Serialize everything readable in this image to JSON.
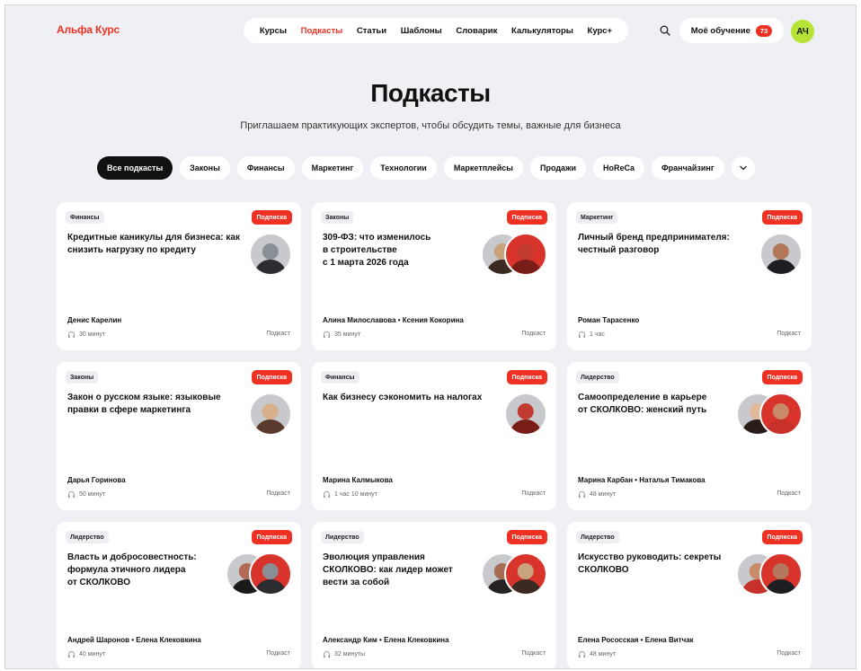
{
  "header": {
    "logo": "Альфа Курс",
    "nav": [
      {
        "label": "Курсы",
        "active": false
      },
      {
        "label": "Подкасты",
        "active": true
      },
      {
        "label": "Статьи",
        "active": false
      },
      {
        "label": "Шаблоны",
        "active": false
      },
      {
        "label": "Словарик",
        "active": false
      },
      {
        "label": "Калькуляторы",
        "active": false
      },
      {
        "label": "Курс+",
        "active": false
      }
    ],
    "search_icon": "search-icon",
    "learning_label": "Моё обучение",
    "learning_count": "73",
    "user_initials": "АЧ"
  },
  "hero": {
    "title": "Подкасты",
    "subtitle": "Приглашаем практикующих экспертов, чтобы обсудить темы, важные для бизнеса"
  },
  "filters": [
    {
      "label": "Все подкасты",
      "active": true
    },
    {
      "label": "Законы",
      "active": false
    },
    {
      "label": "Финансы",
      "active": false
    },
    {
      "label": "Маркетинг",
      "active": false
    },
    {
      "label": "Технологии",
      "active": false
    },
    {
      "label": "Маркетплейсы",
      "active": false
    },
    {
      "label": "Продажи",
      "active": false
    },
    {
      "label": "HoReCa",
      "active": false
    },
    {
      "label": "Франчайзинг",
      "active": false
    }
  ],
  "colors": {
    "accent": "#ef3124",
    "user_avatar": "#b7e335",
    "page_bg": "#eef0f3"
  },
  "cards": [
    {
      "tag": "Финансы",
      "badge": "Подписка",
      "title": "Кредитные каникулы для бизнеса: как снизить нагрузку по кредиту",
      "authors": "Денис Карелин",
      "duration": "30 минут",
      "kind": "Подкаст",
      "photos": 1
    },
    {
      "tag": "Законы",
      "badge": "Подписка",
      "title": "309-ФЗ: что изменилось\nв строительстве\nс 1 марта 2026 года",
      "authors": "Алина Милославова  • Ксения Кокорина",
      "duration": "35 минут",
      "kind": "Подкаст",
      "photos": 2
    },
    {
      "tag": "Маркетинг",
      "badge": "Подписка",
      "title": "Личный бренд предпринимателя: честный разговор",
      "authors": "Роман Тарасенко",
      "duration": "1 час",
      "kind": "Подкаст",
      "photos": 1
    },
    {
      "tag": "Законы",
      "badge": "Подписка",
      "title": "Закон о русском языке: языковые правки в сфере маркетинга",
      "authors": "Дарья Горинова",
      "duration": "50 минут",
      "kind": "Подкаст",
      "photos": 1
    },
    {
      "tag": "Финансы",
      "badge": "Подписка",
      "title": "Как бизнесу сэкономить на налогах",
      "authors": "Марина Калмыкова",
      "duration": "1 час 10 минут",
      "kind": "Подкаст",
      "photos": 1
    },
    {
      "tag": "Лидерство",
      "badge": "Подписка",
      "title": "Самоопределение в карьере\nот СКОЛКОВО: женский путь",
      "authors": "Марина Карбан • Наталья Тимакова",
      "duration": "48 минут",
      "kind": "Подкаст",
      "photos": 2
    },
    {
      "tag": "Лидерство",
      "badge": "Подписка",
      "title": "Власть и добросовестность:\nформула этичного лидера\nот СКОЛКОВО",
      "authors": "Андрей Шаронов • Елена Клековкина",
      "duration": "40 минут",
      "kind": "Подкаст",
      "photos": 2
    },
    {
      "tag": "Лидерство",
      "badge": "Подписка",
      "title": "Эволюция управления\nСКОЛКОВО: как лидер может\nвести за собой",
      "authors": "Александр Ким • Елена Клековкина",
      "duration": "32 минуты",
      "kind": "Подкаст",
      "photos": 2
    },
    {
      "tag": "Лидерство",
      "badge": "Подписка",
      "title": "Искусство руководить: секреты\nСКОЛКОВО",
      "authors": "Елена Рососская  • Елена Витчак",
      "duration": "48 минут",
      "kind": "Подкаст",
      "photos": 2
    }
  ]
}
